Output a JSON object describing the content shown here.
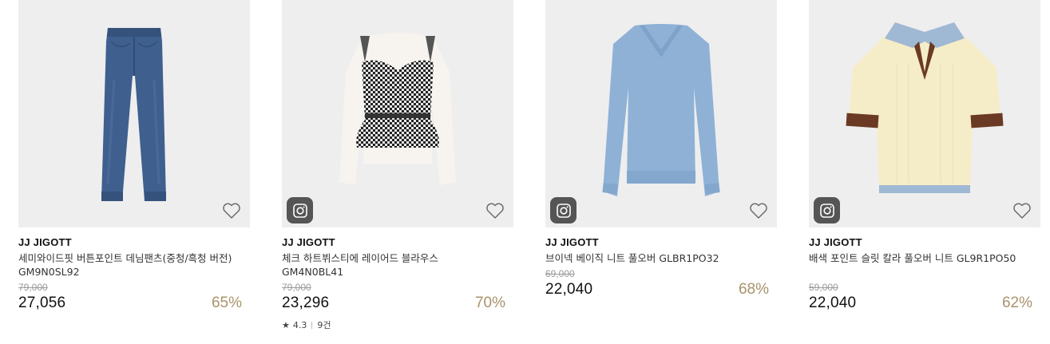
{
  "colors": {
    "thumb_bg": "#eeeeee",
    "discount": "#a9936b",
    "original_price": "#9a9a9a",
    "insta_badge": "#555555"
  },
  "products": [
    {
      "brand": "JJ JIGOTT",
      "name": "세미와이드핏 버튼포인트 데님팬츠(중청/흑청 버전) GM9N0SL92",
      "original_price": "79,000",
      "price": "27,056",
      "discount": "65%",
      "image": "denim-pants",
      "has_insta_badge": false
    },
    {
      "brand": "JJ JIGOTT",
      "name": "체크 하트뷔스티에 레이어드 블라우스 GM4N0BL41",
      "original_price": "79,000",
      "price": "23,296",
      "discount": "70%",
      "image": "check-bustier-blouse",
      "has_insta_badge": true,
      "rating": {
        "score": "4.3",
        "count": "9건"
      }
    },
    {
      "brand": "JJ JIGOTT",
      "name": "브이넥 베이직 니트 풀오버 GLBR1PO32",
      "original_price": "69,000",
      "price": "22,040",
      "discount": "68%",
      "image": "blue-vneck-knit",
      "has_insta_badge": true
    },
    {
      "brand": "JJ JIGOTT",
      "name": "배색 포인트 슬릿 칼라 풀오버 니트 GL9R1PO50",
      "original_price": "59,000",
      "price": "22,040",
      "discount": "62%",
      "image": "collar-knit-pullover",
      "has_insta_badge": true
    }
  ]
}
